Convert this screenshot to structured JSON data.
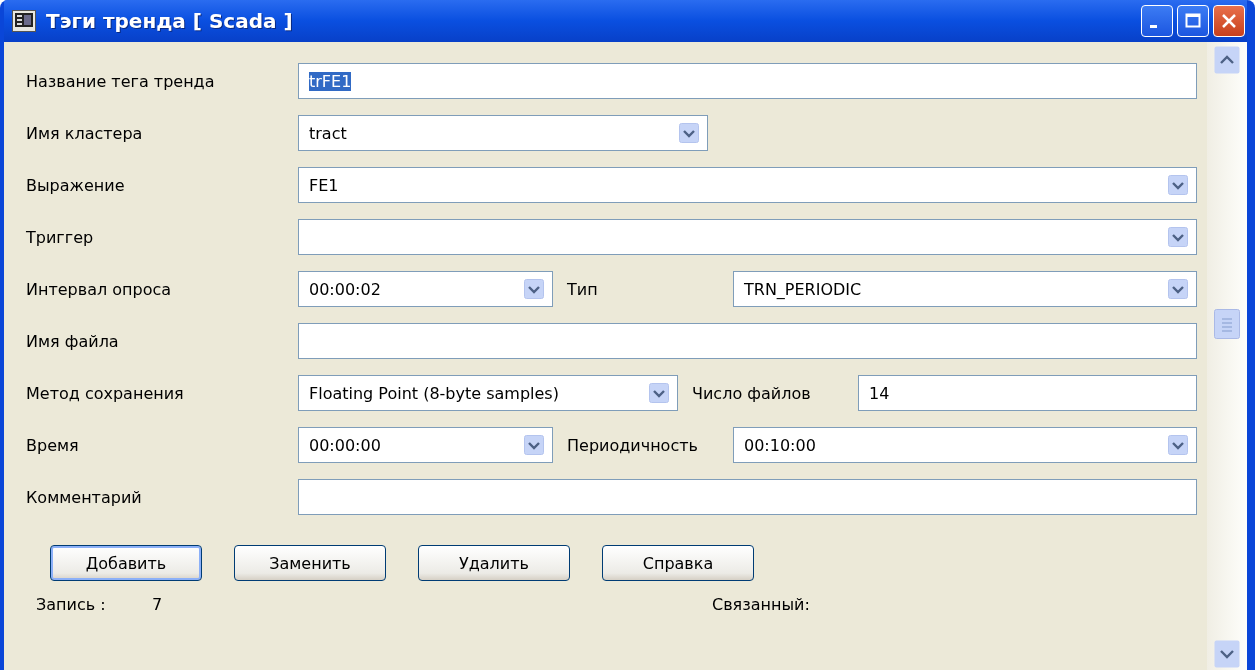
{
  "window": {
    "title": "Тэги тренда [ Scada ]"
  },
  "rows": [
    {
      "label": "Название тега тренда",
      "kind": "text",
      "value": "trFE1",
      "value_selected": true
    },
    {
      "label": "Имя кластера",
      "kind": "combo",
      "value": "tract"
    },
    {
      "label": "Выражение",
      "kind": "combo",
      "value": "FE1"
    },
    {
      "label": "Триггер",
      "kind": "combo",
      "value": ""
    },
    {
      "label": "Интервал опроса",
      "kind": "combo",
      "value": "00:00:02",
      "extra": {
        "label": "Тип",
        "kind": "combo",
        "value": "TRN_PERIODIC"
      }
    },
    {
      "label": "Имя файла",
      "kind": "text",
      "value": ""
    },
    {
      "label": "Метод сохранения",
      "kind": "combo",
      "value": "Floating Point (8-byte samples)",
      "extra": {
        "label": "Число файлов",
        "kind": "text",
        "value": "14"
      }
    },
    {
      "label": "Время",
      "kind": "combo",
      "value": "00:00:00",
      "extra": {
        "label": "Периодичность",
        "kind": "combo",
        "value": "00:10:00"
      }
    },
    {
      "label": "Комментарий",
      "kind": "text",
      "value": ""
    }
  ],
  "buttons": [
    {
      "label": "Добавить",
      "default": true
    },
    {
      "label": "Заменить",
      "default": false
    },
    {
      "label": "Удалить",
      "default": false
    },
    {
      "label": "Справка",
      "default": false
    }
  ],
  "status": {
    "record_label": "Запись :",
    "record_value": "7",
    "linked_label": "Связанный:"
  }
}
